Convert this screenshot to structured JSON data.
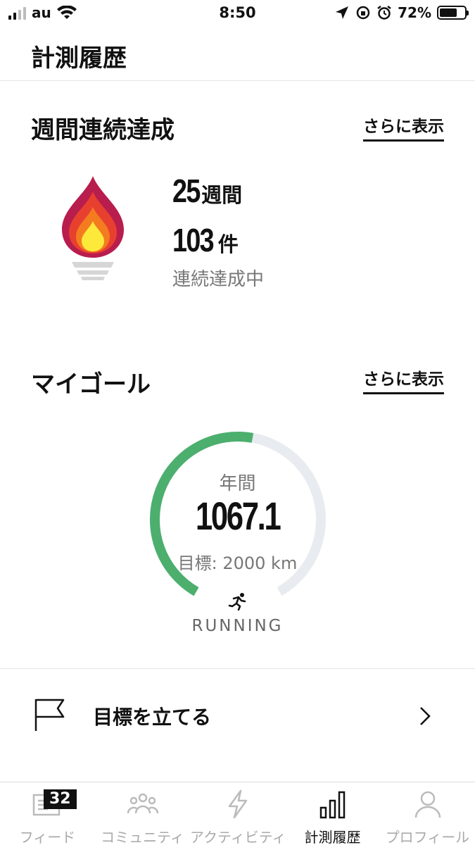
{
  "status_bar": {
    "carrier": "au",
    "time": "8:50",
    "battery": "72%",
    "battery_level": 0.72
  },
  "page": {
    "title": "計測履歴"
  },
  "streak": {
    "section_title": "週間連続達成",
    "more_label": "さらに表示",
    "weeks_value": "25",
    "weeks_unit": "週間",
    "count_value": "103",
    "count_unit": "件",
    "status": "連続達成中",
    "icon": "flame-icon"
  },
  "goal": {
    "section_title": "マイゴール",
    "more_label": "さらに表示",
    "period": "年間",
    "value": "1067.1",
    "target": "目標: 2000 km",
    "progress": 0.534,
    "activity": "RUNNING",
    "progress_color": "#4caf6e",
    "track_color": "#e8ecf0"
  },
  "set_goal": {
    "label": "目標を立てる"
  },
  "tabs": [
    {
      "label": "フィード",
      "icon": "feed-icon",
      "badge": "32"
    },
    {
      "label": "コミュニティ",
      "icon": "community-icon"
    },
    {
      "label": "アクティビティ",
      "icon": "lightning-icon"
    },
    {
      "label": "計測履歴",
      "icon": "bar-chart-icon",
      "active": true
    },
    {
      "label": "プロフィール",
      "icon": "person-icon"
    }
  ]
}
